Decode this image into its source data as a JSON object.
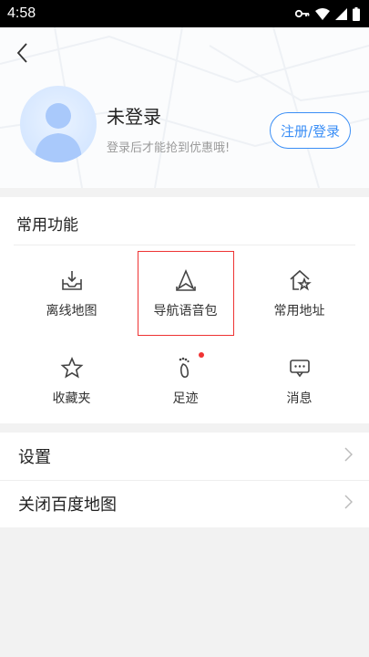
{
  "status_bar": {
    "time": "4:58",
    "icons": [
      "key-icon",
      "wifi-icon",
      "signal-icon",
      "battery-icon"
    ]
  },
  "header": {
    "back_icon": "chevron-left-icon",
    "username": "未登录",
    "login_hint": "登录后才能抢到优惠哦!",
    "login_button": "注册/登录"
  },
  "common": {
    "title": "常用功能",
    "items": [
      {
        "label": "离线地图",
        "icon": "offline-map-icon"
      },
      {
        "label": "导航语音包",
        "icon": "navigation-voice-icon"
      },
      {
        "label": "常用地址",
        "icon": "home-star-icon"
      },
      {
        "label": "收藏夹",
        "icon": "star-icon"
      },
      {
        "label": "足迹",
        "icon": "footprint-icon",
        "badge": true
      },
      {
        "label": "消息",
        "icon": "message-icon"
      }
    ]
  },
  "settings": {
    "items": [
      {
        "label": "设置"
      },
      {
        "label": "关闭百度地图"
      }
    ]
  },
  "colors": {
    "accent": "#3a8ef6",
    "highlight": "#ee3333",
    "badge": "#f03434"
  }
}
